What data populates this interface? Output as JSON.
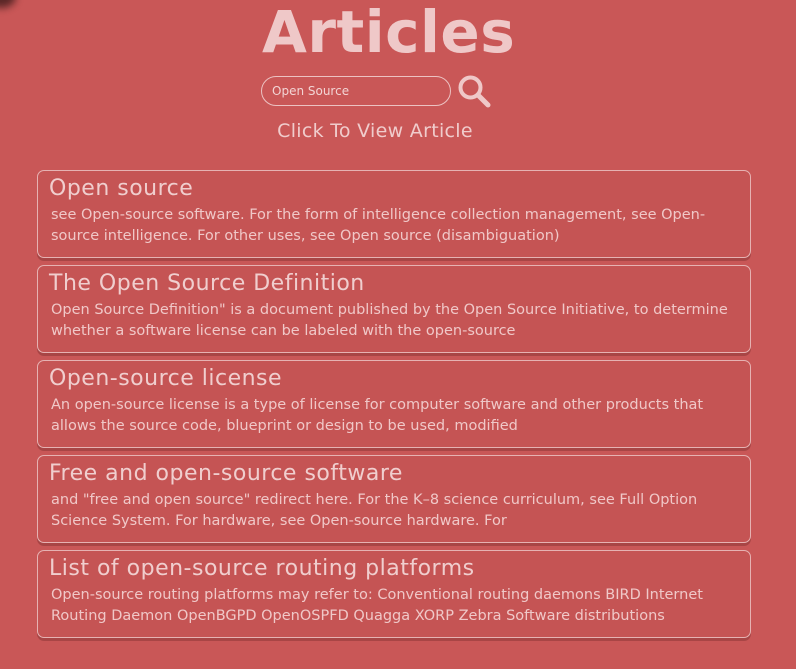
{
  "page": {
    "title": "Articles",
    "subtitle": "Click To View Article"
  },
  "search": {
    "value": "Open Source",
    "placeholder": ""
  },
  "results": [
    {
      "title": "Open source",
      "snippet": "see Open-source software. For the form of intelligence collection management, see Open-source intelligence. For other uses, see Open source (disambiguation)"
    },
    {
      "title": "The Open Source Definition",
      "snippet": "Open Source Definition\" is a document published by the Open Source Initiative, to determine whether a software license can be labeled with the open-source"
    },
    {
      "title": "Open-source license",
      "snippet": "An open-source license is a type of license for computer software and other products that allows the source code, blueprint or design to be used, modified"
    },
    {
      "title": "Free and open-source software",
      "snippet": "and \"free and open source\" redirect here. For the K–8 science curriculum, see Full Option Science System. For hardware, see Open-source hardware. For"
    },
    {
      "title": "List of open-source routing platforms",
      "snippet": "Open-source routing platforms may refer to: Conventional routing daemons BIRD Internet Routing Daemon OpenBGPD OpenOSPFD Quagga XORP Zebra Software distributions"
    }
  ],
  "icons": {
    "search_button": "search-icon"
  },
  "colors": {
    "background": "#c95757",
    "text": "#f0c8c8",
    "card_border": "#e6b2b2"
  }
}
